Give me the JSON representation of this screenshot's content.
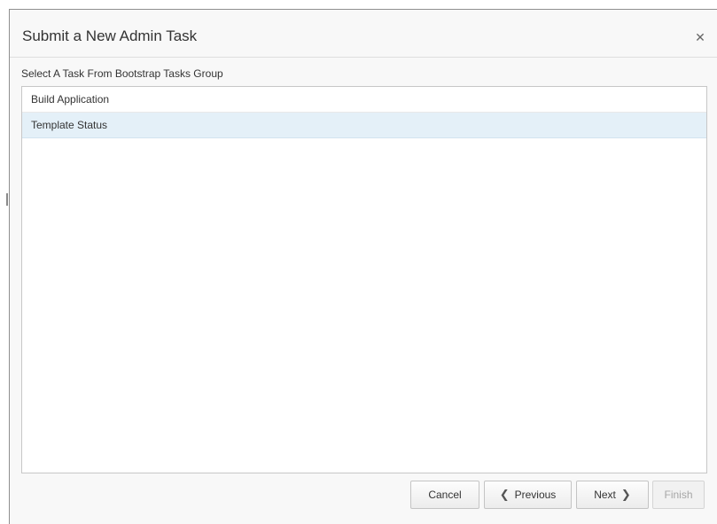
{
  "dialog": {
    "title": "Submit a New Admin Task",
    "close_icon": "close-icon",
    "close_glyph": "✕"
  },
  "task_list": {
    "caption": "Select A Task From Bootstrap Tasks Group",
    "items": [
      {
        "label": "Build Application",
        "selected": false
      },
      {
        "label": "Template Status",
        "selected": true
      }
    ]
  },
  "footer": {
    "cancel_label": "Cancel",
    "previous_label": "Previous",
    "previous_icon": "chevron-left-icon",
    "previous_glyph": "❮",
    "next_label": "Next",
    "next_icon": "chevron-right-icon",
    "next_glyph": "❯",
    "finish_label": "Finish",
    "finish_disabled": true
  },
  "colors": {
    "selected_row": "#e4f0f8",
    "dialog_bg": "#f8f8f8",
    "border": "#c7c7c7"
  }
}
